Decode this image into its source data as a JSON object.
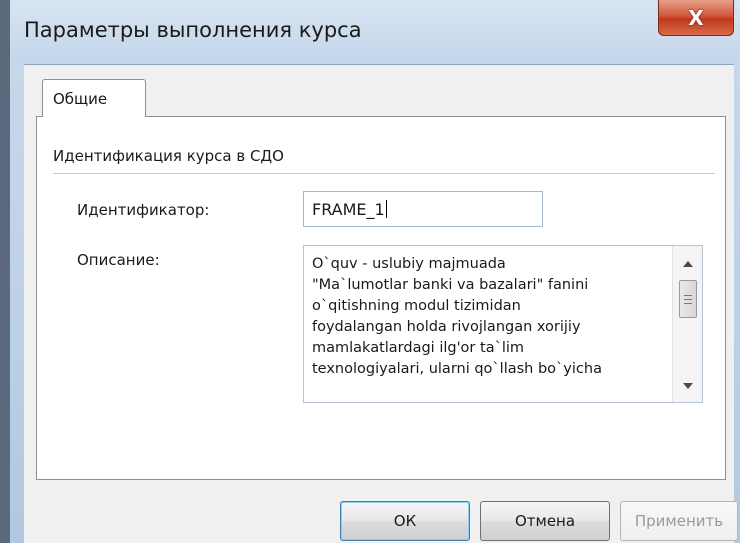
{
  "window": {
    "title": "Параметры выполнения курса",
    "close_label": "X"
  },
  "tabs": [
    {
      "label": "Общие",
      "active": true
    }
  ],
  "group": {
    "label": "Идентификация курса в СДО"
  },
  "fields": {
    "identifier_label": "Идентификатор:",
    "identifier_value": "FRAME_1",
    "description_label": "Описание:",
    "description_value": "O`quv - uslubiy majmuada\n\"Ma`lumotlar banki va bazalari\" fanini\no`qitishning modul tizimidan\nfoydalangan holda rivojlangan xorijiy\nmamlakatlardagi ilg'or ta`lim\ntexnologiyalari, ularni qo`llash bo`yicha"
  },
  "buttons": {
    "ok": "ОК",
    "cancel": "Отмена",
    "apply": "Применить"
  },
  "icons": {
    "scroll_up": "up-arrow-icon",
    "scroll_down": "down-arrow-icon",
    "thumb_grip": "grip-icon"
  },
  "colors": {
    "close_button": "#c8462a",
    "ok_border": "#3c7fb1"
  }
}
